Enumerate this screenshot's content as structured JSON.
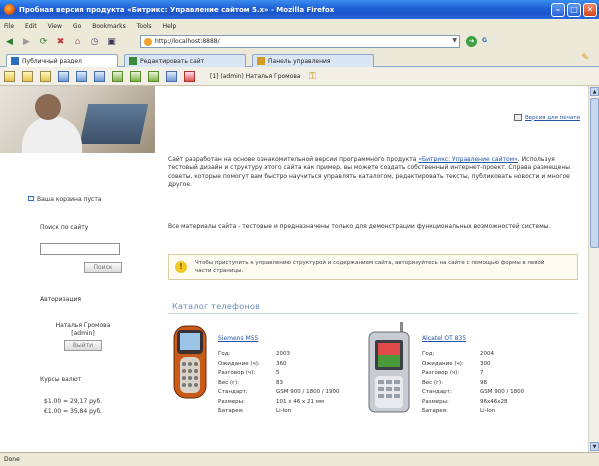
{
  "window": {
    "title": "Пробная версия продукта «Битрикс: Управление сайтом 5.х» - Mozilla Firefox",
    "min": "–",
    "max": "□",
    "close": "✕"
  },
  "menubar": [
    "File",
    "Edit",
    "View",
    "Go",
    "Bookmarks",
    "Tools",
    "Help"
  ],
  "navbar": {
    "url": "http://localhost:8888/",
    "extra": "G"
  },
  "tabs": [
    {
      "label": "Публичный раздел",
      "color": "#2a6fbf"
    },
    {
      "label": "Редактировать сайт",
      "color": "#3b8a3b"
    },
    {
      "label": "Панель управления",
      "color": "#d29a22"
    }
  ],
  "toolbar2": {
    "user": "[1] (admin) Наталья Громова"
  },
  "sidebar": {
    "cart": "Ваша корзина пуста",
    "search_label": "Поиск по сайту",
    "search_button": "Поиск",
    "auth_label": "Авторизация",
    "user_name": "Наталья Громова",
    "user_login": "[admin]",
    "logout_button": "Выйти",
    "rates_label": "Курсы валют",
    "rate_usd": "$1.00 = 29,17 руб.",
    "rate_eur": "€1.00 = 35,84 руб."
  },
  "main": {
    "print_link": "Версия для печати",
    "intro_pre": "Сайт разработан на основе ознакомительной версии программного продукта ",
    "intro_link": "«Битрикс: Управление сайтом»",
    "intro_post": ". Используя тестовый дизайн и структуру этого сайта как пример, вы можете создать собственный интернет-проект. Справа размещены советы, которые помогут вам быстро научиться управлять каталогом, редактировать тексты, публиковать новости и многое другое.",
    "second_para": "Все материалы сайта - тестовые и предназначены только для демонстрации функциональных возможностей системы.",
    "notice": "Чтобы приступить к управлению структурой и содержанием сайта, авторизуйтесь на сайте с помощью формы в левой части страницы.",
    "catalog_title": "Каталог телефонов"
  },
  "phones": [
    {
      "name": "Siemens M55",
      "specs": [
        {
          "k": "Год:",
          "v": "2003"
        },
        {
          "k": "Ожидание (ч):",
          "v": "360"
        },
        {
          "k": "Разговор (ч):",
          "v": "5"
        },
        {
          "k": "Вес (г):",
          "v": "83"
        },
        {
          "k": "Стандарт:",
          "v": "GSM 900 / 1800 / 1900"
        },
        {
          "k": "Размеры:",
          "v": "101 x 46 x 21 мм"
        },
        {
          "k": "Батарея:",
          "v": "Li-Ion"
        }
      ]
    },
    {
      "name": "Alcatel OT 835",
      "specs": [
        {
          "k": "Год:",
          "v": "2004"
        },
        {
          "k": "Ожидание (ч):",
          "v": "300"
        },
        {
          "k": "Разговор (ч):",
          "v": "7"
        },
        {
          "k": "Вес (г):",
          "v": "98"
        },
        {
          "k": "Стандарт:",
          "v": "GSM 900 / 1800"
        },
        {
          "k": "Размеры:",
          "v": "96x46x28"
        },
        {
          "k": "Батарея:",
          "v": "Li-Ion"
        }
      ]
    }
  ],
  "status": "Done"
}
